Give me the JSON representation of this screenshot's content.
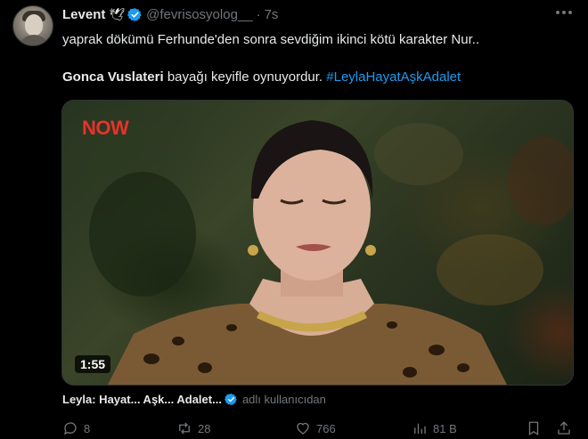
{
  "tweet": {
    "author_name": "Levent",
    "author_emoji": "🕊",
    "handle": "@fevrisosyolog__",
    "separator": "·",
    "time": "7s",
    "line1": "yaprak dökümü Ferhunde'den sonra sevdiğim ikinci kötü karakter Nur..",
    "line2_bold": "Gonca Vuslateri",
    "line2_text": " bayağı keyifle oynuyordur. ",
    "hashtag": "#LeylaHayatAşkAdalet"
  },
  "media": {
    "channel_logo": "NOW",
    "duration": "1:55"
  },
  "source": {
    "name": "Leyla: Hayat... Aşk... Adalet...",
    "by": "adlı kullanıcıdan"
  },
  "actions": {
    "replies": "8",
    "reposts": "28",
    "likes": "766",
    "views": "81 B"
  },
  "colors": {
    "background": "#000000",
    "text": "#e7e9ea",
    "muted": "#71767b",
    "link": "#1d9bf0",
    "now_logo": "#e8322b"
  },
  "icons": [
    "avatar",
    "verified-badge-icon",
    "more-icon",
    "reply-icon",
    "repost-icon",
    "like-icon",
    "views-icon",
    "bookmark-icon",
    "share-icon"
  ]
}
